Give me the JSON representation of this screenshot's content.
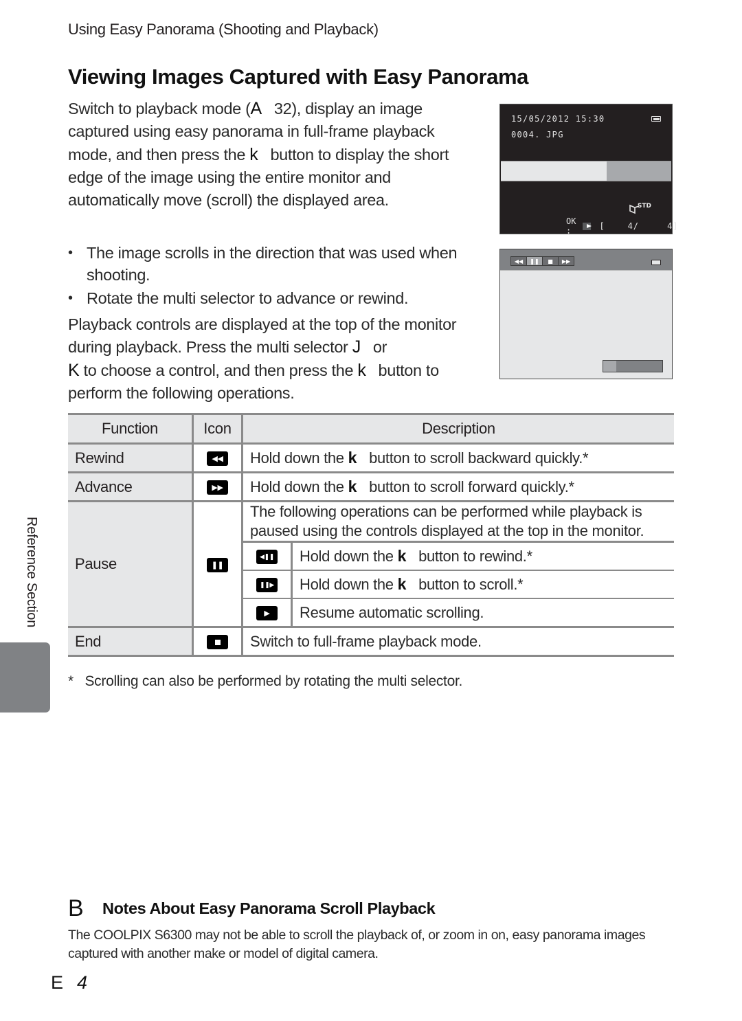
{
  "running_head": "Using Easy Panorama (Shooting and Playback)",
  "title": "Viewing Images Captured with Easy Panorama",
  "intro": {
    "part1": "Switch to playback mode (",
    "ref_symbol": "A",
    "part2": "32), display an image captured using easy panorama in full-frame playback mode, and then press the ",
    "ok_symbol": "k",
    "part3": "button to display the short edge of the image using the entire monitor and automatically move (scroll) the displayed area."
  },
  "bullets": [
    "The image scrolls in the direction that was used when shooting.",
    "Rotate the multi selector to advance or rewind."
  ],
  "para2": {
    "part1": "Playback controls are displayed at the top of the monitor during playback. Press the multi selector ",
    "left_symbol": "J",
    "part2": "or",
    "right_symbol": "K",
    "part3": "to choose a control, and then press the ",
    "ok_symbol": "k",
    "part4": "button to perform the following operations."
  },
  "screen1": {
    "date": "15/05/2012 15:30",
    "file": "0004. JPG",
    "std_label": "STD",
    "ok_label": "OK :",
    "counter": "[    4/     4]",
    "icons": [
      "battery-icon",
      "panorama-std-icon",
      "play-icon"
    ]
  },
  "screen2": {
    "controls": [
      {
        "icon": "rewind-icon",
        "glyph": "◀◀",
        "selected": false
      },
      {
        "icon": "pause-icon",
        "glyph": "❚❚",
        "selected": true
      },
      {
        "icon": "stop-icon",
        "glyph": "■",
        "selected": false
      },
      {
        "icon": "advance-icon",
        "glyph": "▶▶",
        "selected": false
      }
    ],
    "scroll_progress_fraction": 0.22
  },
  "table": {
    "headers": [
      "Function",
      "Icon",
      "Description"
    ],
    "rows": {
      "rewind": {
        "function": "Rewind",
        "icon": "rewind-icon",
        "glyph": "◀◀",
        "desc_pre": "Hold down the ",
        "desc_sym": "k",
        "desc_post": "button to scroll backward quickly.*"
      },
      "advance": {
        "function": "Advance",
        "icon": "advance-icon",
        "glyph": "▶▶",
        "desc_pre": "Hold down the ",
        "desc_sym": "k",
        "desc_post": "button to scroll forward quickly.*"
      },
      "pause": {
        "function": "Pause",
        "icon": "pause-icon",
        "glyph": "❚❚",
        "desc": "The following operations can be performed while playback is paused using the controls displayed at the top in the monitor.",
        "sub": [
          {
            "icon": "step-back-icon",
            "glyph": "◀❚❚",
            "desc_pre": "Hold down the ",
            "desc_sym": "k",
            "desc_post": "button to rewind.*"
          },
          {
            "icon": "step-forward-icon",
            "glyph": "❚❚▶",
            "desc_pre": "Hold down the ",
            "desc_sym": "k",
            "desc_post": "button to scroll.*"
          },
          {
            "icon": "play-icon",
            "glyph": "▶",
            "desc": "Resume automatic scrolling."
          }
        ]
      },
      "end": {
        "function": "End",
        "icon": "stop-icon",
        "desc": "Switch to full-frame playback mode."
      }
    }
  },
  "footnote": "*   Scrolling can also be performed by rotating the multi selector.",
  "side_label": "Reference Section",
  "note": {
    "symbol": "B",
    "title": "Notes About Easy Panorama Scroll Playback",
    "text": "The COOLPIX S6300 may not be able to scroll the playback of, or zoom in on, easy panorama images captured with another make or model of digital camera."
  },
  "page_number": {
    "prefix": "E",
    "number": "4"
  }
}
